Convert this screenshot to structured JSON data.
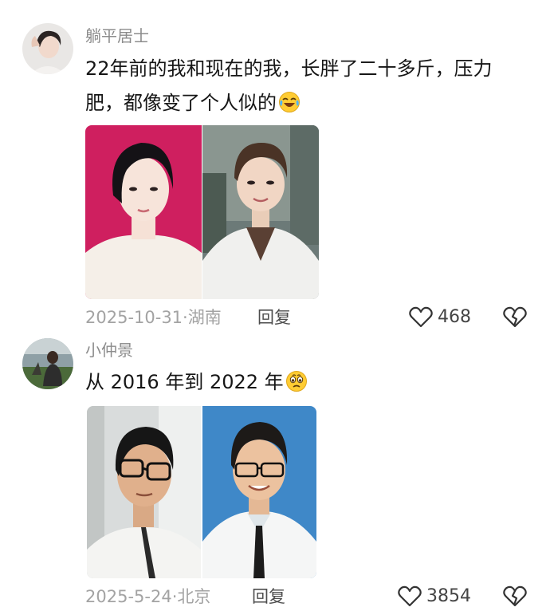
{
  "comments": [
    {
      "username": "躺平居士",
      "text_line1": "22年前的我和现在的我，长胖了二十多斤，压力",
      "text_line2": "肥，都像变了个人似的",
      "emoji": "crying-laughing-emoji",
      "meta_date": "2025-10-31",
      "meta_sep": "·",
      "meta_location": "湖南",
      "reply_label": "回复",
      "like_count": "468"
    },
    {
      "username": "小仲景",
      "text_line1": "从 2016 年到 2022 年",
      "emoji": "holding-back-tears-emoji",
      "meta_date": "2025-5-24",
      "meta_sep": "·",
      "meta_location": "北京",
      "reply_label": "回复",
      "like_count": "3854"
    }
  ],
  "icons": {
    "like": "heart-outline-icon",
    "dislike": "broken-heart-icon"
  },
  "colors": {
    "username": "#8c8c8c",
    "meta": "#a3a3a3",
    "text": "#161616"
  }
}
